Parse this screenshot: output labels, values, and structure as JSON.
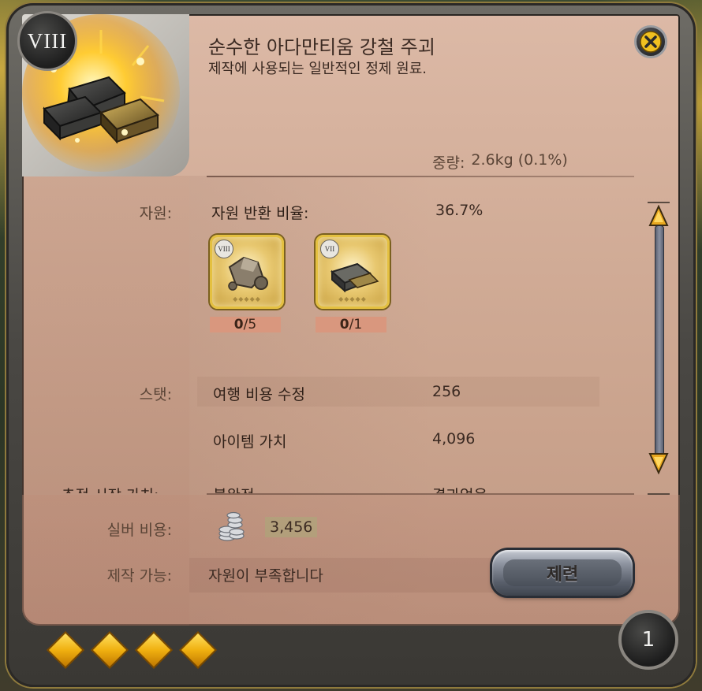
{
  "item": {
    "tier": "VIII",
    "name": "순수한 아다만티움 강철 주괴",
    "description": "제작에 사용되는 일반적인 정제 원료.",
    "weight_label": "중량:",
    "weight_value": "2.6kg (0.1%)"
  },
  "resources": {
    "section_label": "자원:",
    "return_rate_label": "자원 반환 비율:",
    "return_rate_value": "36.7%",
    "items": [
      {
        "icon": "ore-icon",
        "tier": "VIII",
        "have": "0",
        "need": "/5"
      },
      {
        "icon": "ingot-icon",
        "tier": "VII",
        "have": "0",
        "need": "/1"
      }
    ]
  },
  "stats": {
    "section_label": "스탯:",
    "rows": [
      {
        "label": "여행 비용 수정",
        "value": "256"
      },
      {
        "label": "아이템 가치",
        "value": "4,096"
      }
    ],
    "cutoff_left": "추정 시장 가치:",
    "cutoff_mid": "불완전",
    "cutoff_right": "결과없음"
  },
  "cost": {
    "silver_label": "실버 비용:",
    "silver_value": "3,456",
    "craftable_label": "제작 가능:",
    "craftable_value": "자원이 부족합니다"
  },
  "actions": {
    "refine_label": "제련"
  },
  "footer": {
    "quality_count": 4,
    "quantity": "1"
  },
  "colors": {
    "panel": "#d2ad98",
    "accent_gold": "#f0b010",
    "count_bar": "#d9977e"
  }
}
